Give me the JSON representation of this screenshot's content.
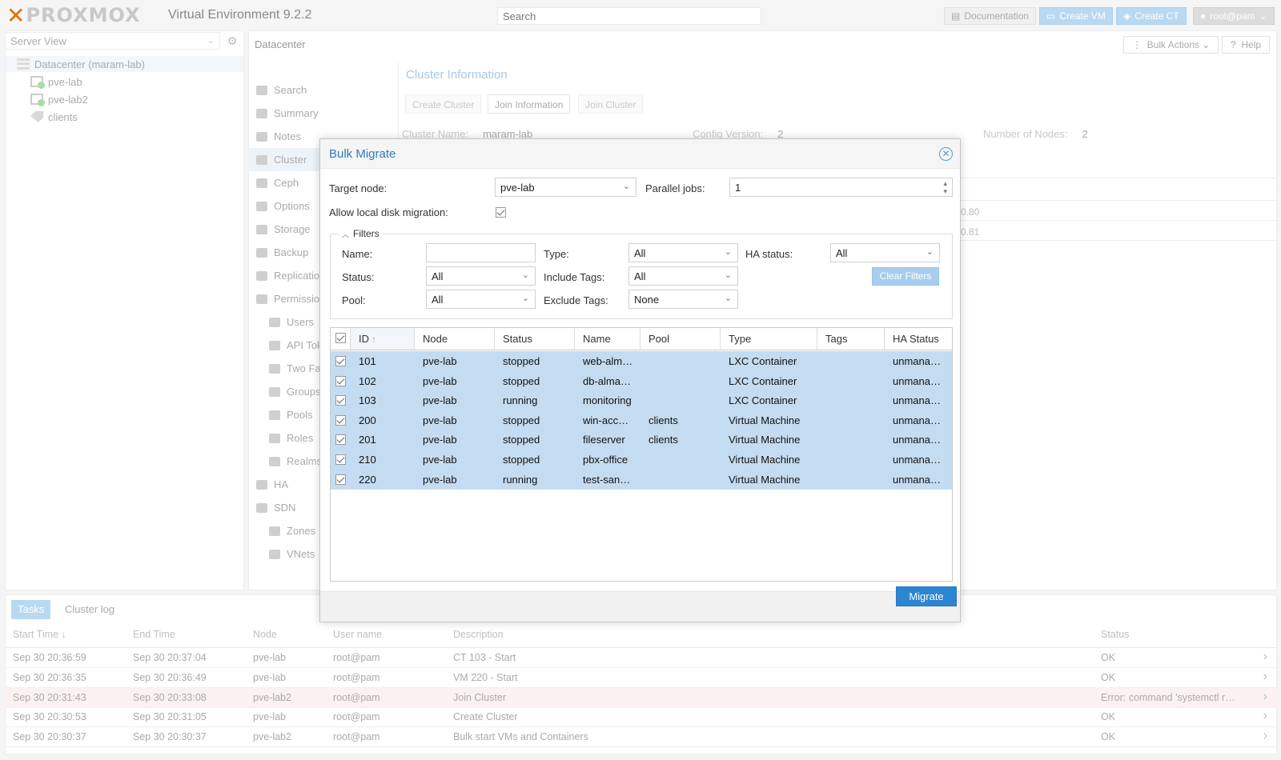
{
  "header": {
    "logo_text": "PROXMOX",
    "version": "Virtual Environment 9.2.2",
    "search_placeholder": "Search",
    "buttons": {
      "documentation": "Documentation",
      "create_vm": "Create VM",
      "create_ct": "Create CT",
      "user": "root@pam"
    }
  },
  "tree": {
    "view_selector": "Server View",
    "items": [
      {
        "label": "Datacenter (maram-lab)",
        "icon": "datacenter-icon"
      },
      {
        "label": "pve-lab",
        "icon": "node-online-icon"
      },
      {
        "label": "pve-lab2",
        "icon": "node-online-icon"
      },
      {
        "label": "clients",
        "icon": "tag-icon"
      }
    ]
  },
  "content": {
    "title": "Datacenter",
    "bulk_actions": "Bulk Actions",
    "help": "Help",
    "nav": [
      {
        "label": "Search",
        "icon": "search-icon"
      },
      {
        "label": "Summary",
        "icon": "book-icon"
      },
      {
        "label": "Notes",
        "icon": "note-icon"
      },
      {
        "label": "Cluster",
        "icon": "server-icon"
      },
      {
        "label": "Ceph",
        "icon": "ceph-icon"
      },
      {
        "label": "Options",
        "icon": "gear-icon"
      },
      {
        "label": "Storage",
        "icon": "database-icon"
      },
      {
        "label": "Backup",
        "icon": "floppy-icon"
      },
      {
        "label": "Replication",
        "icon": "retweet-icon"
      },
      {
        "label": "Permissions",
        "icon": "unlock-icon"
      },
      {
        "label": "Users",
        "icon": "user-icon"
      },
      {
        "label": "API Tokens",
        "icon": "key-icon"
      },
      {
        "label": "Two Factor",
        "icon": "key-icon"
      },
      {
        "label": "Groups",
        "icon": "users-icon"
      },
      {
        "label": "Pools",
        "icon": "tags-icon"
      },
      {
        "label": "Roles",
        "icon": "male-icon"
      },
      {
        "label": "Realms",
        "icon": "building-icon"
      },
      {
        "label": "HA",
        "icon": "heartbeat-icon"
      },
      {
        "label": "SDN",
        "icon": "sdn-icon"
      },
      {
        "label": "Zones",
        "icon": "grid-icon"
      },
      {
        "label": "VNets",
        "icon": "network-icon"
      }
    ],
    "cluster": {
      "title": "Cluster Information",
      "buttons": [
        "Create Cluster",
        "Join Information",
        "Join Cluster"
      ],
      "cluster_name_label": "Cluster Name:",
      "cluster_name": "maram-lab",
      "config_version_label": "Config Version:",
      "config_version": "2",
      "nodes_label": "Number of Nodes:",
      "nodes": "2",
      "ip_fragments": [
        "0.80",
        "0.81"
      ]
    }
  },
  "dialog": {
    "title": "Bulk Migrate",
    "target_node_label": "Target node:",
    "target_node": "pve-lab",
    "parallel_jobs_label": "Parallel jobs:",
    "parallel_jobs": "1",
    "local_disk_label": "Allow local disk migration:",
    "local_disk_checked": true,
    "filters": {
      "legend": "Filters",
      "name_label": "Name:",
      "name_value": "",
      "type_label": "Type:",
      "type_value": "All",
      "ha_label": "HA status:",
      "ha_value": "All",
      "status_label": "Status:",
      "status_value": "All",
      "include_tags_label": "Include Tags:",
      "include_tags_value": "All",
      "pool_label": "Pool:",
      "pool_value": "All",
      "exclude_tags_label": "Exclude Tags:",
      "exclude_tags_value": "None",
      "clear_button": "Clear Filters"
    },
    "columns": [
      "ID",
      "Node",
      "Status",
      "Name",
      "Pool",
      "Type",
      "Tags",
      "HA Status"
    ],
    "rows": [
      {
        "id": "101",
        "node": "pve-lab",
        "status": "stopped",
        "name": "web-alm…",
        "pool": "",
        "type": "LXC Container",
        "tags": "",
        "ha": "unmana…"
      },
      {
        "id": "102",
        "node": "pve-lab",
        "status": "stopped",
        "name": "db-alma…",
        "pool": "",
        "type": "LXC Container",
        "tags": "",
        "ha": "unmana…"
      },
      {
        "id": "103",
        "node": "pve-lab",
        "status": "running",
        "name": "monitoring",
        "pool": "",
        "type": "LXC Container",
        "tags": "",
        "ha": "unmana…"
      },
      {
        "id": "200",
        "node": "pve-lab",
        "status": "stopped",
        "name": "win-acc…",
        "pool": "clients",
        "type": "Virtual Machine",
        "tags": "",
        "ha": "unmana…"
      },
      {
        "id": "201",
        "node": "pve-lab",
        "status": "stopped",
        "name": "fileserver",
        "pool": "clients",
        "type": "Virtual Machine",
        "tags": "",
        "ha": "unmana…"
      },
      {
        "id": "210",
        "node": "pve-lab",
        "status": "stopped",
        "name": "pbx-office",
        "pool": "",
        "type": "Virtual Machine",
        "tags": "",
        "ha": "unmana…"
      },
      {
        "id": "220",
        "node": "pve-lab",
        "status": "running",
        "name": "test-san…",
        "pool": "",
        "type": "Virtual Machine",
        "tags": "",
        "ha": "unmana…"
      }
    ],
    "migrate_button": "Migrate"
  },
  "tasks": {
    "tabs": [
      "Tasks",
      "Cluster log"
    ],
    "columns": [
      "Start Time",
      "End Time",
      "Node",
      "User name",
      "Description",
      "Status"
    ],
    "rows": [
      {
        "start": "Sep 30 20:36:59",
        "end": "Sep 30 20:37:04",
        "node": "pve-lab",
        "user": "root@pam",
        "desc": "CT 103 - Start",
        "status": "OK",
        "error": false
      },
      {
        "start": "Sep 30 20:36:35",
        "end": "Sep 30 20:36:49",
        "node": "pve-lab",
        "user": "root@pam",
        "desc": "VM 220 - Start",
        "status": "OK",
        "error": false
      },
      {
        "start": "Sep 30 20:31:43",
        "end": "Sep 30 20:33:08",
        "node": "pve-lab2",
        "user": "root@pam",
        "desc": "Join Cluster",
        "status": "Error: command 'systemctl r…",
        "error": true
      },
      {
        "start": "Sep 30 20:30:53",
        "end": "Sep 30 20:31:05",
        "node": "pve-lab",
        "user": "root@pam",
        "desc": "Create Cluster",
        "status": "OK",
        "error": false
      },
      {
        "start": "Sep 30 20:30:37",
        "end": "Sep 30 20:30:37",
        "node": "pve-lab2",
        "user": "root@pam",
        "desc": "Bulk start VMs and Containers",
        "status": "OK",
        "error": false
      }
    ]
  }
}
